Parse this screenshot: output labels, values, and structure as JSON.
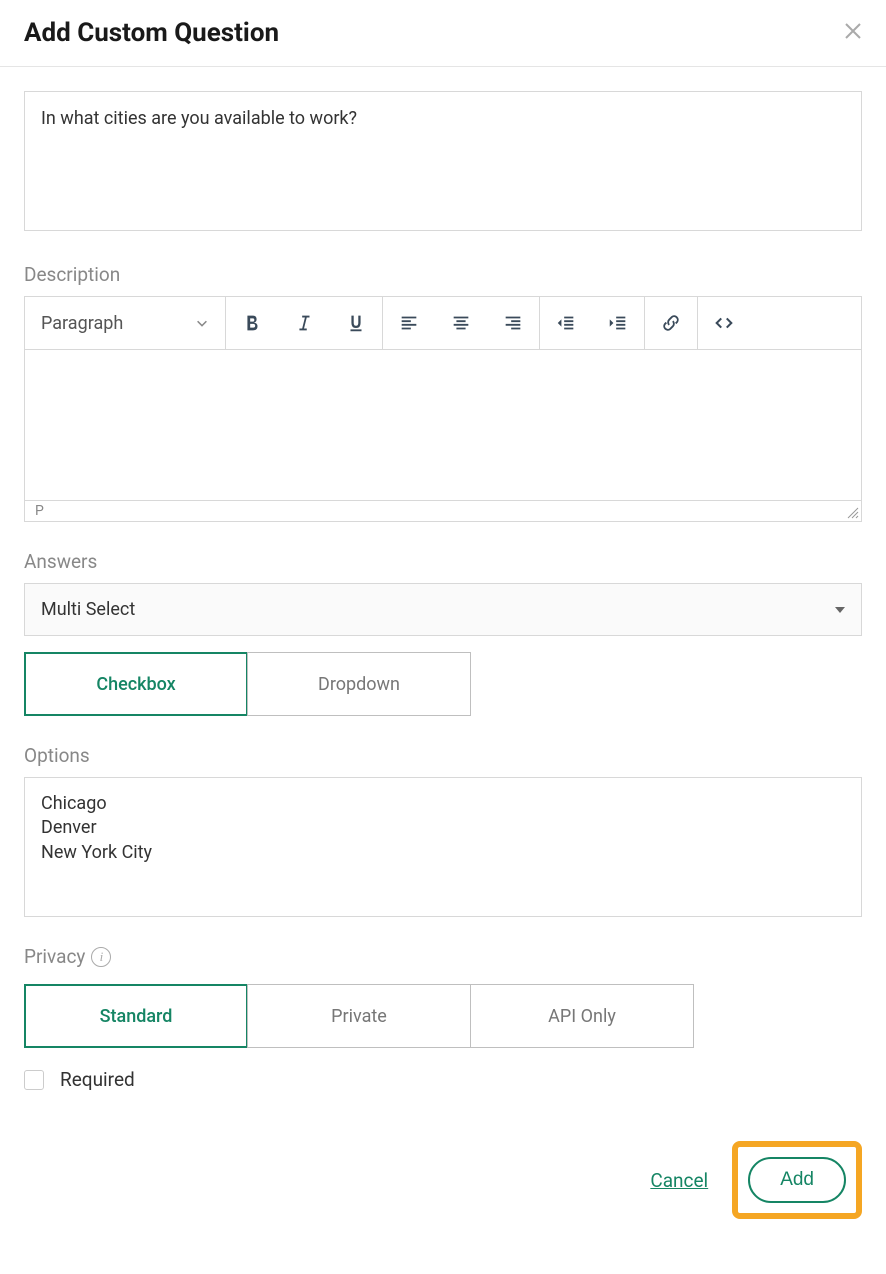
{
  "header": {
    "title": "Add Custom Question"
  },
  "question": {
    "value": "In what cities are you available to work?"
  },
  "description": {
    "label": "Description",
    "format_selected": "Paragraph",
    "footer": "P"
  },
  "answers": {
    "label": "Answers",
    "selected": "Multi Select",
    "toggles": {
      "checkbox": "Checkbox",
      "dropdown": "Dropdown"
    }
  },
  "options": {
    "label": "Options",
    "value": "Chicago\nDenver\nNew York City"
  },
  "privacy": {
    "label": "Privacy",
    "toggles": {
      "standard": "Standard",
      "private": "Private",
      "api_only": "API Only"
    }
  },
  "required": {
    "label": "Required"
  },
  "footer": {
    "cancel": "Cancel",
    "add": "Add"
  }
}
